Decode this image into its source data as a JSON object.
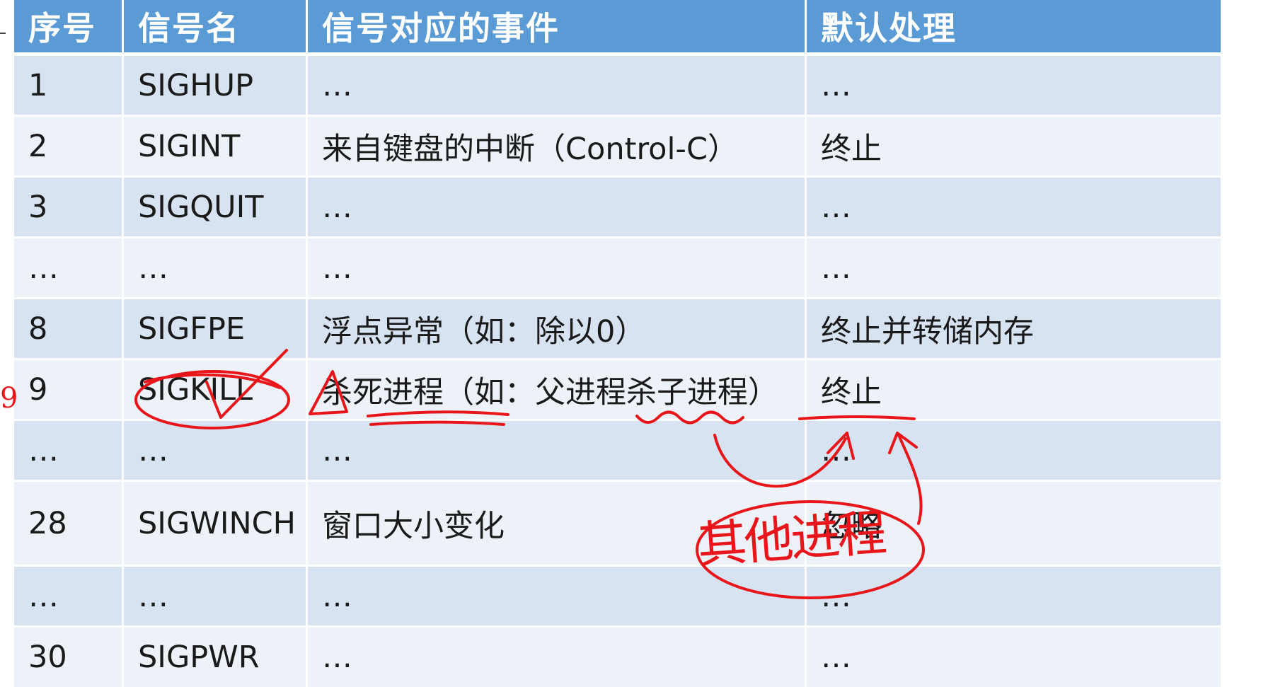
{
  "table": {
    "headers": [
      "序号",
      "信号名",
      "信号对应的事件",
      "默认处理"
    ],
    "rows": [
      [
        "1",
        "SIGHUP",
        "…",
        "…"
      ],
      [
        "2",
        "SIGINT",
        "来自键盘的中断（Control-C）",
        "终止"
      ],
      [
        "3",
        "SIGQUIT",
        "…",
        "…"
      ],
      [
        "…",
        "…",
        "…",
        "…"
      ],
      [
        "8",
        "SIGFPE",
        "浮点异常（如：除以0）",
        "终止并转储内存"
      ],
      [
        "9",
        "SIGKILL",
        "杀死进程（如：父进程杀子进程）",
        "终止"
      ],
      [
        "…",
        "…",
        "…",
        "…"
      ],
      [
        "28",
        "SIGWINCH",
        "窗口大小变化",
        "忽略"
      ],
      [
        "…",
        "…",
        "…",
        "…"
      ],
      [
        "30",
        "SIGPWR",
        "…",
        "…"
      ]
    ]
  },
  "annotations": {
    "handwritten_note": "其他进程",
    "left_margin_mark": "9"
  },
  "colors": {
    "header_bg": "#5b9bd5",
    "row_odd_bg": "#d7e3f1",
    "row_even_bg": "#edf2f8",
    "ink": "#e8161a"
  }
}
